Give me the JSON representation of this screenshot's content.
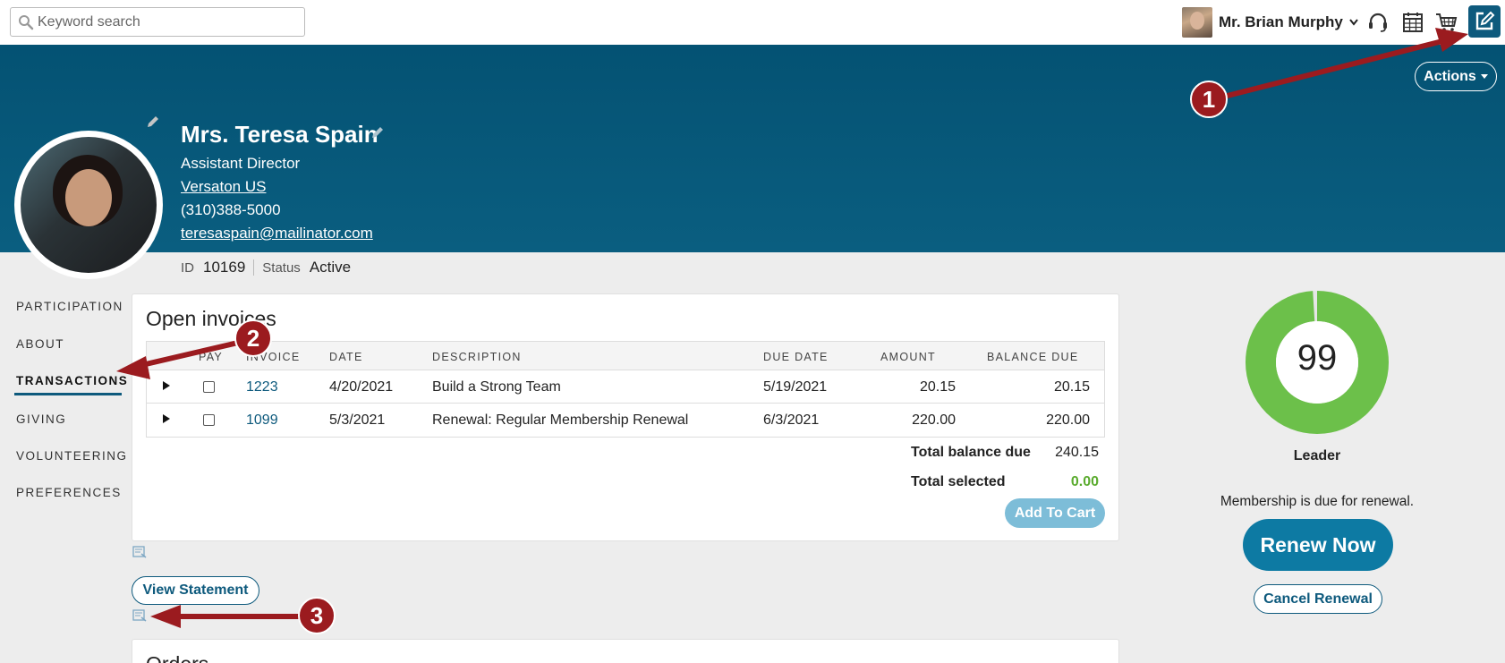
{
  "search": {
    "placeholder": "Keyword search"
  },
  "user": {
    "name": "Mr. Brian Murphy"
  },
  "actions_label": "Actions",
  "profile": {
    "name": "Mrs. Teresa Spain",
    "title": "Assistant Director",
    "company": "Versaton US",
    "phone": "(310)388-5000",
    "email": "teresaspain@mailinator.com",
    "id_label": "ID",
    "id_value": "10169",
    "status_label": "Status",
    "status_value": "Active"
  },
  "nav": [
    "PARTICIPATION",
    "ABOUT",
    "TRANSACTIONS",
    "GIVING",
    "VOLUNTEERING",
    "PREFERENCES"
  ],
  "invoices": {
    "title": "Open invoices",
    "columns": [
      "PAY",
      "INVOICE",
      "DATE",
      "DESCRIPTION",
      "DUE DATE",
      "AMOUNT",
      "BALANCE DUE"
    ],
    "rows": [
      {
        "invoice": "1223",
        "date": "4/20/2021",
        "description": "Build a Strong Team",
        "due": "5/19/2021",
        "amount": "20.15",
        "balance": "20.15"
      },
      {
        "invoice": "1099",
        "date": "5/3/2021",
        "description": "Renewal: Regular Membership Renewal",
        "due": "6/3/2021",
        "amount": "220.00",
        "balance": "220.00"
      }
    ],
    "total_balance_label": "Total balance due",
    "total_balance_value": "240.15",
    "total_selected_label": "Total selected",
    "total_selected_value": "0.00",
    "add_to_cart": "Add To Cart"
  },
  "view_statement": "View Statement",
  "orders_title": "Orders",
  "membership": {
    "score": "99",
    "score_fraction": 0.99,
    "level": "Leader",
    "message": "Membership is due for renewal.",
    "renew_label": "Renew Now",
    "cancel_label": "Cancel Renewal"
  },
  "annotations": [
    "1",
    "2",
    "3"
  ],
  "colors": {
    "banner": "#045273",
    "accent": "#0e5a7d",
    "donut": "#6cc04a",
    "arrow": "#9b1b1f",
    "total_selected": "#5aab2e"
  }
}
